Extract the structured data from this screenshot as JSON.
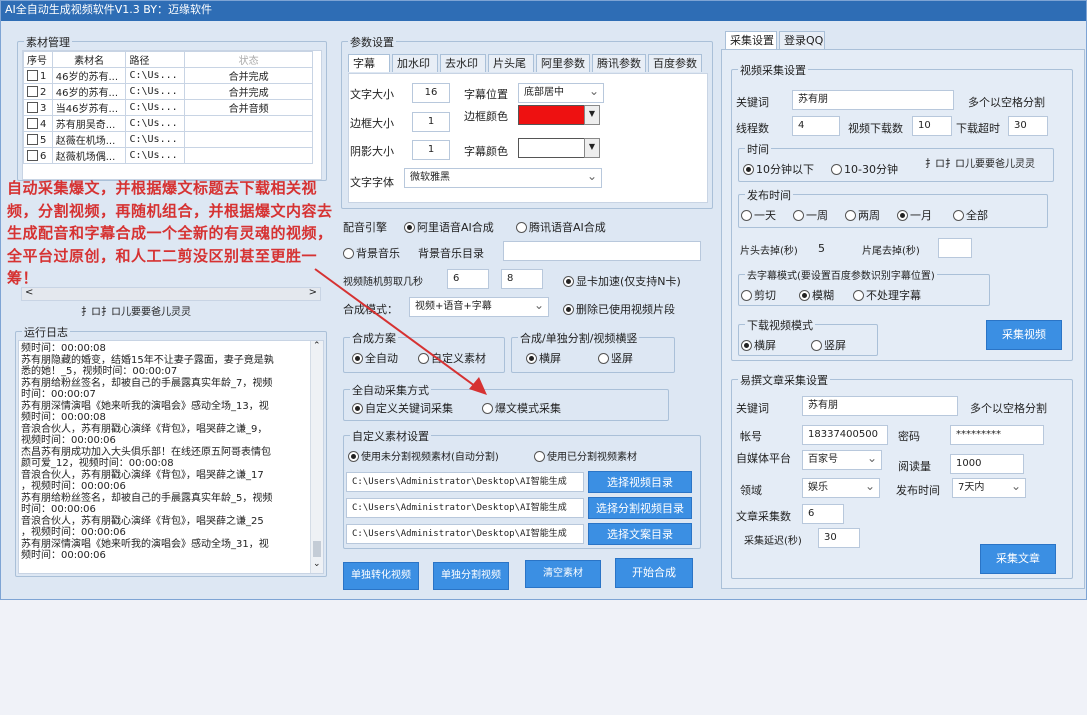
{
  "title": "AI全自动生成视频软件V1.3 BY：迈缘软件",
  "material": {
    "title": "素材管理",
    "columns": [
      "序号",
      "素材名",
      "路径",
      "状态"
    ],
    "rows": [
      {
        "num": "1",
        "name": "46岁的苏有...",
        "path": "C:\\Us...",
        "status": "合并完成"
      },
      {
        "num": "2",
        "name": "46岁的苏有...",
        "path": "C:\\Us...",
        "status": "合并完成"
      },
      {
        "num": "3",
        "name": "当46岁苏有...",
        "path": "C:\\Us...",
        "status": "合并音频"
      },
      {
        "num": "4",
        "name": "苏有朋吴奇...",
        "path": "C:\\Us...",
        "status": ""
      },
      {
        "num": "5",
        "name": "赵薇在机场...",
        "path": "C:\\Us...",
        "status": ""
      },
      {
        "num": "6",
        "name": "赵薇机场偶...",
        "path": "C:\\Us...",
        "status": ""
      }
    ],
    "status_text": "扌ロ扌ロ儿要要爸儿灵灵"
  },
  "overlay_text": "自动采集爆文，并根据爆文标题去下载相关视频，分割视频，再随机组合，并根据爆文内容去生成配音和字幕合成一个全新的有灵魂的视频，全平台过原创，和人工二剪没区别甚至更胜一筹！",
  "log": {
    "title": "运行日志",
    "lines": [
      "频时间：00:00:08",
      "苏有朋隐藏的婚变，结婚15年不让妻子露面，妻子竟是孰",
      "悉的她！_5，视频时间：00:00:07",
      "苏有朋给粉丝签名，却被自己的手晨露真实年龄_7，视频",
      "时间：00:00:07",
      "苏有朋深情演唱《她来听我的演唱会》感动全场_13，视",
      "频时间：00:00:08",
      "音浪合伙人，苏有朋戳心演绎《背包》，唱哭薛之谦_9，",
      "视频时间：00:00:06",
      "杰昌苏有朋成功加入大头俱乐部！在线还原五阿哥表情包",
      "颜可爱_12，视频时间：00:00:08",
      "音浪合伙人，苏有朋戳心演绎《背包》，唱哭薛之谦_17",
      "，视频时间：00:00:06",
      "苏有朋给粉丝签名，却被自己的手晨露真实年龄_5，视频",
      "时间：00:00:06",
      "音浪合伙人，苏有朋戳心演绎《背包》，唱哭薛之谦_25",
      "，视频时间：00:00:06",
      "苏有朋深情演唱《她来听我的演唱会》感动全场_31，视",
      "频时间：00:00:06"
    ]
  },
  "params": {
    "title": "参数设置",
    "tabs": [
      "字幕",
      "加水印",
      "去水印",
      "片头尾",
      "阿里参数",
      "腾讯参数",
      "百度参数"
    ],
    "font_size_label": "文字大小",
    "font_size": "16",
    "sub_pos_label": "字幕位置",
    "sub_pos": "底部居中",
    "border_label": "边框大小",
    "border": "1",
    "border_color_label": "边框颜色",
    "shadow_label": "阴影大小",
    "shadow": "1",
    "sub_color_label": "字幕颜色",
    "font_label": "文字字体",
    "font": "微软雅黑",
    "border_color": "#ee1111",
    "sub_color": "#ffffff"
  },
  "engine": {
    "label": "配音引擎",
    "opt1": "阿里语音AI合成",
    "opt2": "腾讯语音AI合成",
    "bgm": "背景音乐",
    "bgm_dir_label": "背景音乐目录",
    "cut_label": "视频随机剪取几秒",
    "cut_min": "6",
    "cut_max": "8",
    "gpu": "显卡加速(仅支持N卡)",
    "mode_label": "合成模式：",
    "mode": "视频+语音+字幕",
    "delete_used": "删除已使用视频片段"
  },
  "compose": {
    "scheme_title": "合成方案",
    "auto": "全自动",
    "custom_mat": "自定义素材",
    "orient_title": "合成/单独分割/视频横竖",
    "landscape": "横屏",
    "portrait": "竖屏",
    "collect_title": "全自动采集方式",
    "custom_kw": "自定义关键词采集",
    "hot_mode": "爆文模式采集",
    "custom_set_title": "自定义素材设置",
    "use_unsplit": "使用未分割视频素材(自动分割)",
    "use_split": "使用已分割视频素材",
    "path1": "C:\\Users\\Administrator\\Desktop\\AI智能生成",
    "path2": "C:\\Users\\Administrator\\Desktop\\AI智能生成",
    "path3": "C:\\Users\\Administrator\\Desktop\\AI智能生成",
    "btn_video_dir": "选择视频目录",
    "btn_split_dir": "选择分割视频目录",
    "btn_text_dir": "选择文案目录"
  },
  "bottom_buttons": {
    "convert": "单独转化视频",
    "split": "单独分割视频",
    "clear": "清空素材",
    "start": "开始合成"
  },
  "right": {
    "tabs": [
      "采集设置",
      "登录QQ"
    ],
    "video_title": "视频采集设置",
    "keyword_label": "关键词",
    "keyword": "苏有朋",
    "keyword_hint": "多个以空格分割",
    "threads_label": "线程数",
    "threads": "4",
    "dl_count_label": "视频下载数",
    "dl_count": "10",
    "timeout_label": "下载超时",
    "timeout": "30",
    "time_title": "时间",
    "time_opt1": "10分钟以下",
    "time_opt2": "10-30分钟",
    "time_status": "扌ロ扌ロ儿要要爸儿灵灵",
    "pub_title": "发布时间",
    "pub_opts": [
      "一天",
      "一周",
      "两周",
      "一月",
      "全部"
    ],
    "head_cut_label": "片头去掉(秒)",
    "head_cut": "5",
    "tail_cut_label": "片尾去掉(秒)",
    "tail_cut": "",
    "sub_mode_title": "去字幕模式(要设置百度参数识别字幕位置)",
    "sub_opts": [
      "剪切",
      "模糊",
      "不处理字幕"
    ],
    "dl_mode_title": "下载视频模式",
    "dl_landscape": "横屏",
    "dl_portrait": "竖屏",
    "collect_video_btn": "采集视频",
    "article_title": "易撰文章采集设置",
    "a_keyword_label": "关键词",
    "a_keyword": "苏有朋",
    "a_keyword_hint": "多个以空格分割",
    "account_label": "帐号",
    "account": "18337400500",
    "password_label": "密码",
    "password": "*********",
    "platform_label": "自媒体平台",
    "platform": "百家号",
    "reads_label": "阅读量",
    "reads": "1000",
    "field_label": "领域",
    "field": "娱乐",
    "pubtime_label": "发布时间",
    "pubtime": "7天内",
    "article_count_label": "文章采集数",
    "article_count": "6",
    "delay_label": "采集延迟(秒)",
    "delay": "30",
    "collect_article_btn": "采集文章"
  }
}
